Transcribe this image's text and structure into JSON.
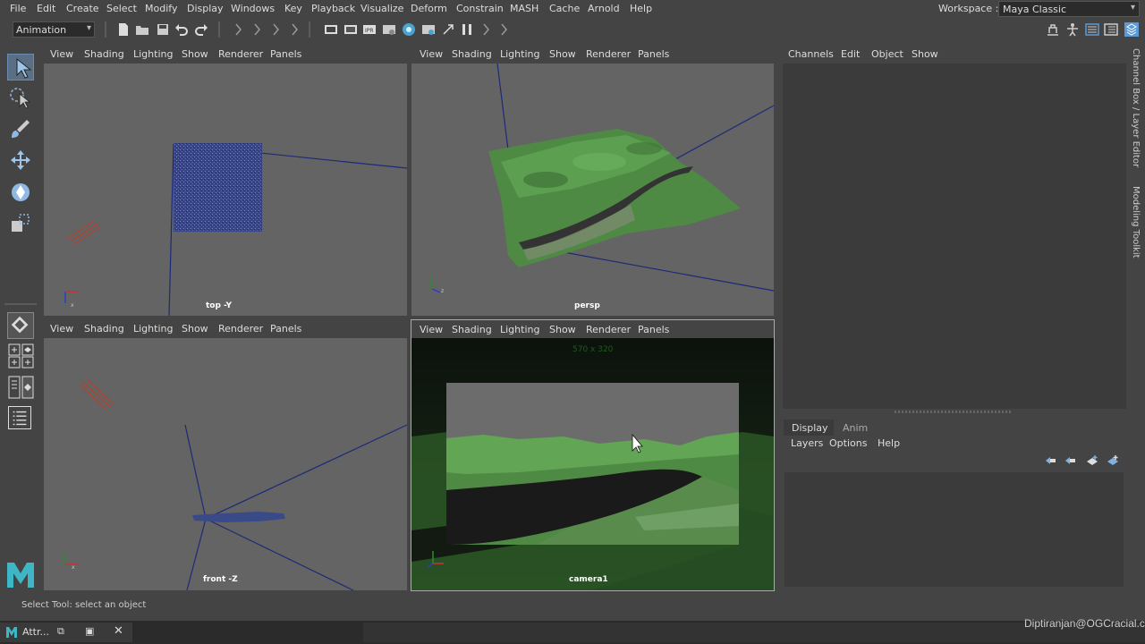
{
  "menubar": {
    "items": [
      "File",
      "Edit",
      "Create",
      "Select",
      "Modify",
      "Display",
      "Windows",
      "Key",
      "Playback",
      "Visualize",
      "Deform",
      "Constrain",
      "MASH",
      "Cache",
      "Arnold",
      "Help"
    ],
    "workspace_label": "Workspace :",
    "workspace_value": "Maya Classic"
  },
  "toolbar": {
    "menuset": "Animation"
  },
  "viewport_menu": [
    "View",
    "Shading",
    "Lighting",
    "Show",
    "Renderer",
    "Panels"
  ],
  "viewports": {
    "top": {
      "label": "top -Y"
    },
    "persp": {
      "label": "persp"
    },
    "front": {
      "label": "front -Z"
    },
    "camera": {
      "label": "camera1",
      "resolution": "570 x 320"
    }
  },
  "channel_box": {
    "menu": [
      "Channels",
      "Edit",
      "Object",
      "Show"
    ],
    "side_tabs": [
      "Channel Box / Layer Editor",
      "Modeling Toolkit"
    ]
  },
  "layer_editor": {
    "tabs": [
      "Display",
      "Anim"
    ],
    "menu": [
      "Layers",
      "Options",
      "Help"
    ]
  },
  "status": {
    "help_line": "Select Tool: select an object"
  },
  "taskbar": {
    "app_label": "Attr...",
    "watermark": "Diptiranjan@OGCracial.com"
  },
  "colors": {
    "accent": "#5b9bd5",
    "viewport_bg": "#646464",
    "terrain_green": "#4f8f4a"
  }
}
